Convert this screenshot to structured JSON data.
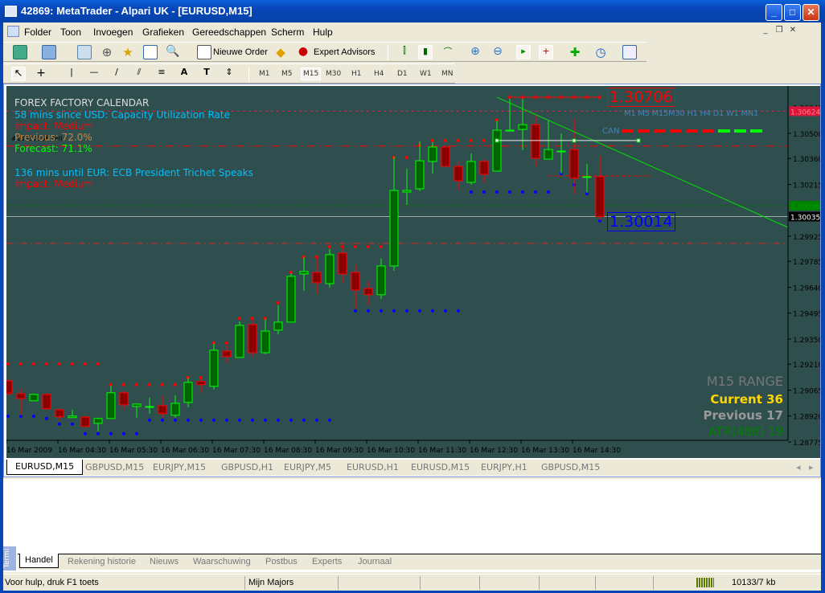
{
  "window": {
    "title": "42869: MetaTrader - Alpari UK - [EURUSD,M15]",
    "minimize": "_",
    "maximize": "□",
    "close": "✕"
  },
  "menu": [
    "Folder",
    "Toon",
    "Invoegen",
    "Grafieken",
    "Gereedschappen",
    "Scherm",
    "Hulp"
  ],
  "toolbar": {
    "new_order": "Nieuwe Order",
    "expert_advisors": "Expert Advisors"
  },
  "timeframes": [
    "M1",
    "M5",
    "M15",
    "M30",
    "H1",
    "H4",
    "D1",
    "W1",
    "MN"
  ],
  "selected_timeframe": "M15",
  "calendar": {
    "title": "FOREX FACTORY CALENDAR",
    "event1": "58 mins since USD: Capacity Utilization Rate",
    "impact1": "Impact: Medium",
    "previous": "Previous: 72.0%",
    "forecast": "Forecast: 71.1%",
    "event2": "136 mins until EUR: ECB President Trichet Speaks",
    "impact2": "Impact: Medium"
  },
  "order_label": "#10330556 sell",
  "mtf": {
    "labels": "M1 M5 M15M30 H1 H4 D1 W1 MN1",
    "can": "CAN",
    "states": [
      "red",
      "red",
      "red",
      "red",
      "red",
      "red",
      "green",
      "green",
      "green"
    ]
  },
  "price_labels": {
    "high": "1.30706",
    "low": "1.30014",
    "order": "1.30624",
    "ask": "1.30096",
    "bid": "1.30035"
  },
  "range": {
    "title": "M15 RANGE",
    "current": "Current 36",
    "previous": "Previous 17",
    "atr": "ATR(480) 19"
  },
  "colors": {
    "background": "#2f4f4f",
    "bull": "#00ff00",
    "bull_body": "#006400",
    "bear": "#ff0000",
    "bear_body": "#8b0000",
    "resistance_dots": "#ff0000",
    "support_dots": "#0000ff"
  },
  "chart_data": {
    "type": "candlestick",
    "symbol": "EURUSD,M15",
    "y_ticks": [
      "1.30645",
      "1.30500",
      "1.30360",
      "1.30215",
      "1.29925",
      "1.29785",
      "1.29640",
      "1.29495",
      "1.29350",
      "1.29210",
      "1.29065",
      "1.28920",
      "1.28775"
    ],
    "ylim": [
      1.2874,
      1.3086
    ],
    "x_labels": [
      {
        "bar": 1,
        "text": "16 Mar 2009"
      },
      {
        "bar": 5,
        "text": "16 Mar 04:30"
      },
      {
        "bar": 9,
        "text": "16 Mar 05:30"
      },
      {
        "bar": 13,
        "text": "16 Mar 06:30"
      },
      {
        "bar": 17,
        "text": "16 Mar 07:30"
      },
      {
        "bar": 21,
        "text": "16 Mar 08:30"
      },
      {
        "bar": 25,
        "text": "16 Mar 09:30"
      },
      {
        "bar": 29,
        "text": "16 Mar 10:30"
      },
      {
        "bar": 33,
        "text": "16 Mar 11:30"
      },
      {
        "bar": 37,
        "text": "16 Mar 12:30"
      },
      {
        "bar": 41,
        "text": "16 Mar 13:30"
      },
      {
        "bar": 45,
        "text": "16 Mar 14:30"
      }
    ],
    "ohlc": [
      [
        1.29117,
        1.29126,
        1.29036,
        1.29045
      ],
      [
        1.29045,
        1.29077,
        1.28924,
        1.29018
      ],
      [
        1.29005,
        1.29045,
        1.29005,
        1.29041
      ],
      [
        1.29041,
        1.2905,
        1.28955,
        1.2896
      ],
      [
        1.28955,
        1.28964,
        1.28893,
        1.28915
      ],
      [
        1.28911,
        1.28955,
        1.28911,
        1.2892
      ],
      [
        1.28915,
        1.2892,
        1.28861,
        1.28861
      ],
      [
        1.28879,
        1.28911,
        1.28834,
        1.28906
      ],
      [
        1.28906,
        1.2909,
        1.28906,
        1.2905
      ],
      [
        1.2905,
        1.29063,
        1.28955,
        1.28982
      ],
      [
        1.28973,
        1.28987,
        1.28911,
        1.28987
      ],
      [
        1.28973,
        1.29023,
        1.28933,
        1.28973
      ],
      [
        1.28978,
        1.29036,
        1.28911,
        1.28933
      ],
      [
        1.28924,
        1.29036,
        1.28911,
        1.28991
      ],
      [
        1.28996,
        1.29135,
        1.28969,
        1.29108
      ],
      [
        1.29113,
        1.29131,
        1.2905,
        1.29095
      ],
      [
        1.29086,
        1.29328,
        1.29068,
        1.29288
      ],
      [
        1.29283,
        1.29315,
        1.29216,
        1.29252
      ],
      [
        1.29247,
        1.29449,
        1.29247,
        1.29427
      ],
      [
        1.29431,
        1.29472,
        1.29247,
        1.29274
      ],
      [
        1.29274,
        1.29463,
        1.29265,
        1.29395
      ],
      [
        1.294,
        1.29539,
        1.29377,
        1.29445
      ],
      [
        1.29445,
        1.29719,
        1.29445,
        1.29701
      ],
      [
        1.29714,
        1.29809,
        1.2962,
        1.29728
      ],
      [
        1.29723,
        1.29818,
        1.29602,
        1.29665
      ],
      [
        1.2966,
        1.29853,
        1.29638,
        1.29822
      ],
      [
        1.29831,
        1.29867,
        1.29665,
        1.29714
      ],
      [
        1.29723,
        1.29764,
        1.29517,
        1.29624
      ],
      [
        1.29633,
        1.29674,
        1.29539,
        1.29598
      ],
      [
        1.29598,
        1.298,
        1.29575,
        1.29759
      ],
      [
        1.29759,
        1.3037,
        1.29732,
        1.30181
      ],
      [
        1.30172,
        1.30302,
        1.301,
        1.30181
      ],
      [
        1.3019,
        1.30455,
        1.30177,
        1.30347
      ],
      [
        1.30343,
        1.30451,
        1.30275,
        1.30424
      ],
      [
        1.30424,
        1.3043,
        1.30316,
        1.30316
      ],
      [
        1.30316,
        1.30343,
        1.30181,
        1.30235
      ],
      [
        1.30226,
        1.30388,
        1.30213,
        1.30343
      ],
      [
        1.30343,
        1.30356,
        1.30222,
        1.30271
      ],
      [
        1.30289,
        1.30572,
        1.30289,
        1.30518
      ],
      [
        1.30513,
        1.30693,
        1.30513,
        1.30518
      ],
      [
        1.30522,
        1.30693,
        1.30406,
        1.30549
      ],
      [
        1.30549,
        1.30603,
        1.30316,
        1.30361
      ],
      [
        1.30356,
        1.30576,
        1.30356,
        1.3041
      ],
      [
        1.30401,
        1.305,
        1.30275,
        1.30401
      ],
      [
        1.3041,
        1.30585,
        1.30159,
        1.30249
      ],
      [
        1.30258,
        1.30329,
        1.30168,
        1.30258
      ],
      [
        1.30258,
        1.30374,
        1.30014,
        1.30035
      ]
    ],
    "resistance_dots": [
      [
        1.29211,
        1,
        8
      ],
      [
        1.29095,
        9,
        14
      ],
      [
        1.29135,
        15,
        16
      ],
      [
        1.29328,
        17,
        18
      ],
      [
        1.29465,
        19,
        21
      ],
      [
        1.29553,
        22,
        22
      ],
      [
        1.29723,
        23,
        23
      ],
      [
        1.29809,
        24,
        25
      ],
      [
        1.29867,
        26,
        30
      ],
      [
        1.30365,
        31,
        32
      ],
      [
        1.30433,
        33,
        33
      ],
      [
        1.3046,
        34,
        38
      ],
      [
        1.30576,
        39,
        39
      ],
      [
        1.30702,
        40,
        47
      ]
    ],
    "support_dots": [
      [
        1.28919,
        1,
        3
      ],
      [
        1.28906,
        4,
        4
      ],
      [
        1.28875,
        5,
        6
      ],
      [
        1.28821,
        7,
        11
      ],
      [
        1.28897,
        12,
        26
      ],
      [
        1.29508,
        28,
        36
      ],
      [
        1.30172,
        37,
        43
      ],
      [
        1.30275,
        44,
        44
      ],
      [
        1.30213,
        45,
        45
      ],
      [
        1.30163,
        46,
        46
      ],
      [
        1.30011,
        47,
        47
      ]
    ],
    "trendline": {
      "from_bar": 39,
      "from_price": 1.30702,
      "to_bar": 61.6,
      "to_price": 1.29975
    },
    "white_line": {
      "price": 1.3046,
      "from_bar": 39,
      "to_bar": 50
    },
    "levels": {
      "order": 1.30624,
      "sell_order": 1.30429,
      "lower_red": 1.29885,
      "short_red": 1.30262,
      "ask": 1.30096,
      "bid": 1.30035
    }
  },
  "chart_tabs": [
    "EURUSD,M15",
    "GBPUSD,M15",
    "EURJPY,M15",
    "GBPUSD,H1",
    "EURJPY,M5",
    "EURUSD,H1",
    "EURUSD,M15",
    "EURJPY,H1",
    "GBPUSD,M15"
  ],
  "terminal": {
    "side_tab": "Termi",
    "tabs": [
      "Handel",
      "Rekening historie",
      "Nieuws",
      "Waarschuwing",
      "Postbus",
      "Experts",
      "Journaal"
    ]
  },
  "status": {
    "help": "Voor hulp, druk F1 toets",
    "profile": "Mijn Majors",
    "traffic": "10133/7 kb"
  }
}
